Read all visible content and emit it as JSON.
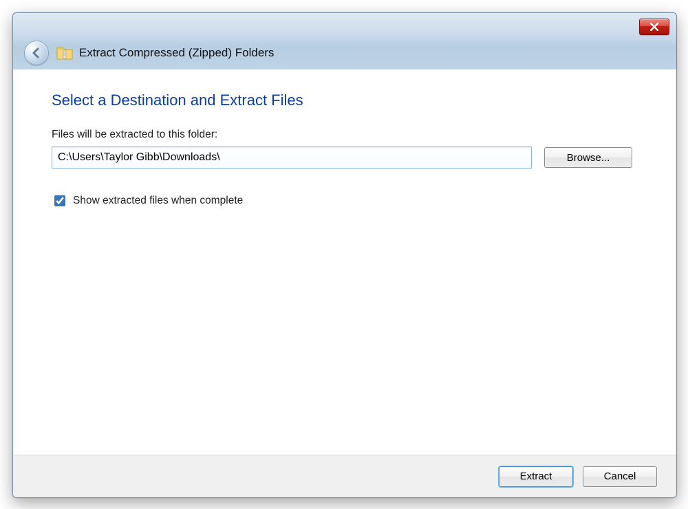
{
  "titlebar": {
    "title": "Extract Compressed (Zipped) Folders"
  },
  "content": {
    "heading": "Select a Destination and Extract Files",
    "path_label": "Files will be extracted to this folder:",
    "path_value": "C:\\Users\\Taylor Gibb\\Downloads\\",
    "browse_label": "Browse...",
    "show_when_complete_label": "Show extracted files when complete",
    "show_when_complete_checked": true
  },
  "footer": {
    "extract_label": "Extract",
    "cancel_label": "Cancel"
  }
}
